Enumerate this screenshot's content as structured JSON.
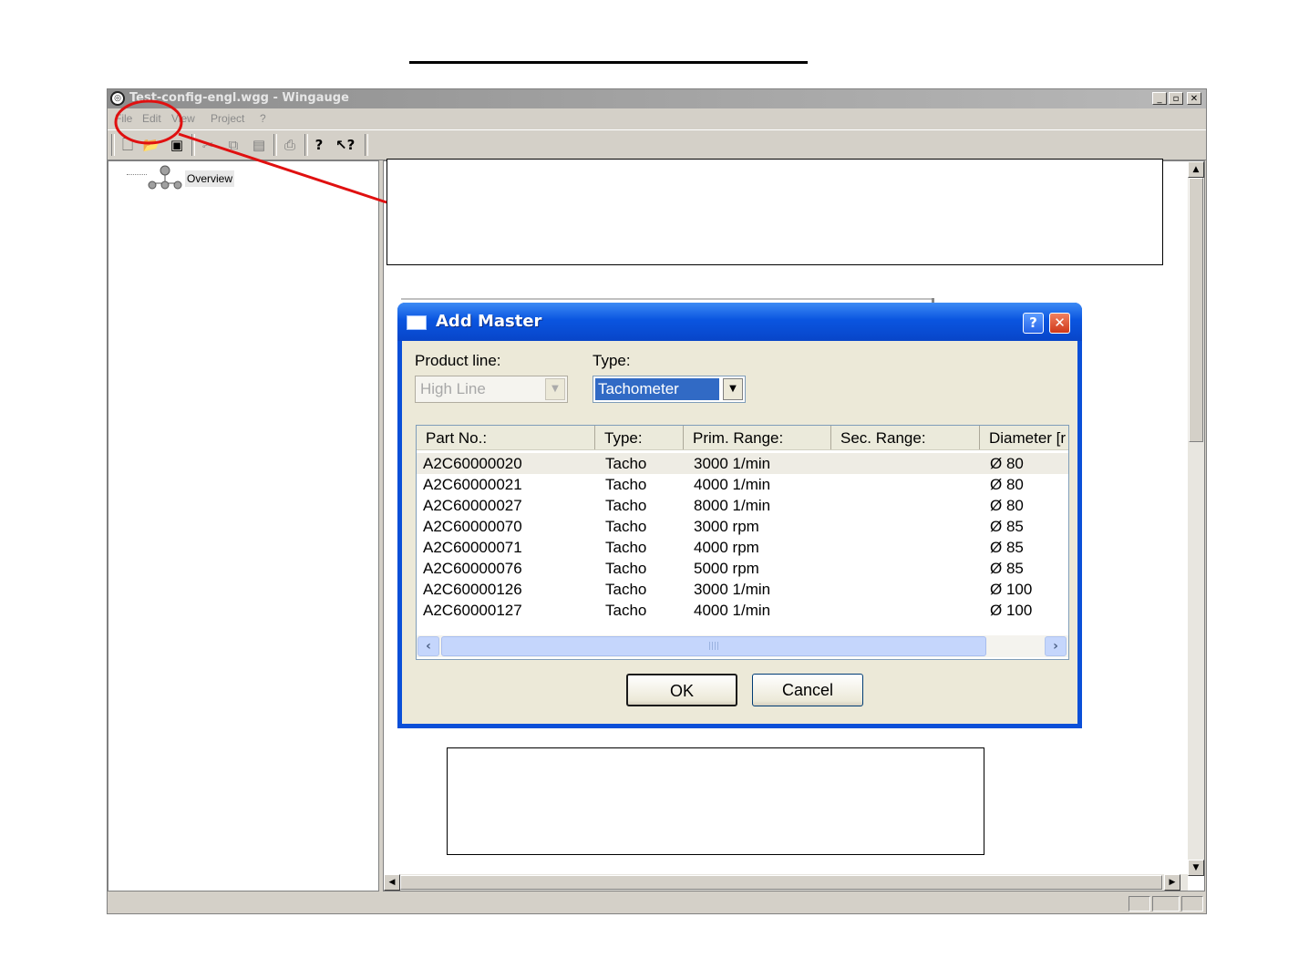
{
  "window": {
    "title": "Test-config-engl.wgg - Wingauge",
    "app_icon": "wingauge-icon",
    "controls": {
      "minimize": "_",
      "restore": "▫",
      "close": "✕"
    }
  },
  "menu": {
    "items": [
      {
        "label": "File"
      },
      {
        "label": "Edit"
      },
      {
        "label": "View"
      },
      {
        "label": "Project"
      },
      {
        "label": "?"
      }
    ]
  },
  "toolbar": {
    "icons": [
      "new-file-icon",
      "open-folder-icon",
      "save-icon",
      "cut-icon",
      "copy-icon",
      "paste-icon",
      "print-icon",
      "help-icon",
      "context-help-icon"
    ]
  },
  "tree": {
    "root_label": "Overview"
  },
  "dialog": {
    "title": "Add Master",
    "help_glyph": "?",
    "close_glyph": "✕",
    "product_line_label": "Product line:",
    "product_line_value": "High Line",
    "type_label": "Type:",
    "type_value": "Tachometer",
    "columns": [
      "Part No.:",
      "Type:",
      "Prim. Range:",
      "Sec. Range:",
      "Diameter [r"
    ],
    "rows": [
      {
        "part": "A2C60000020",
        "type": "Tacho",
        "prim": "3000 1/min",
        "sec": "",
        "diameter": "Ø 80"
      },
      {
        "part": "A2C60000021",
        "type": "Tacho",
        "prim": "4000 1/min",
        "sec": "",
        "diameter": "Ø 80"
      },
      {
        "part": "A2C60000027",
        "type": "Tacho",
        "prim": "8000 1/min",
        "sec": "",
        "diameter": "Ø 80"
      },
      {
        "part": "A2C60000070",
        "type": "Tacho",
        "prim": "3000 rpm",
        "sec": "",
        "diameter": "Ø 85"
      },
      {
        "part": "A2C60000071",
        "type": "Tacho",
        "prim": "4000 rpm",
        "sec": "",
        "diameter": "Ø 85"
      },
      {
        "part": "A2C60000076",
        "type": "Tacho",
        "prim": "5000 rpm",
        "sec": "",
        "diameter": "Ø 85"
      },
      {
        "part": "A2C60000126",
        "type": "Tacho",
        "prim": "3000 1/min",
        "sec": "",
        "diameter": "Ø 100"
      },
      {
        "part": "A2C60000127",
        "type": "Tacho",
        "prim": "4000 1/min",
        "sec": "",
        "diameter": "Ø 100"
      }
    ],
    "selected_row": 0,
    "ok_label": "OK",
    "cancel_label": "Cancel"
  },
  "colors": {
    "dialog_title": "#0a55e0",
    "selection": "#316ac5",
    "annotation": "#e01010"
  }
}
